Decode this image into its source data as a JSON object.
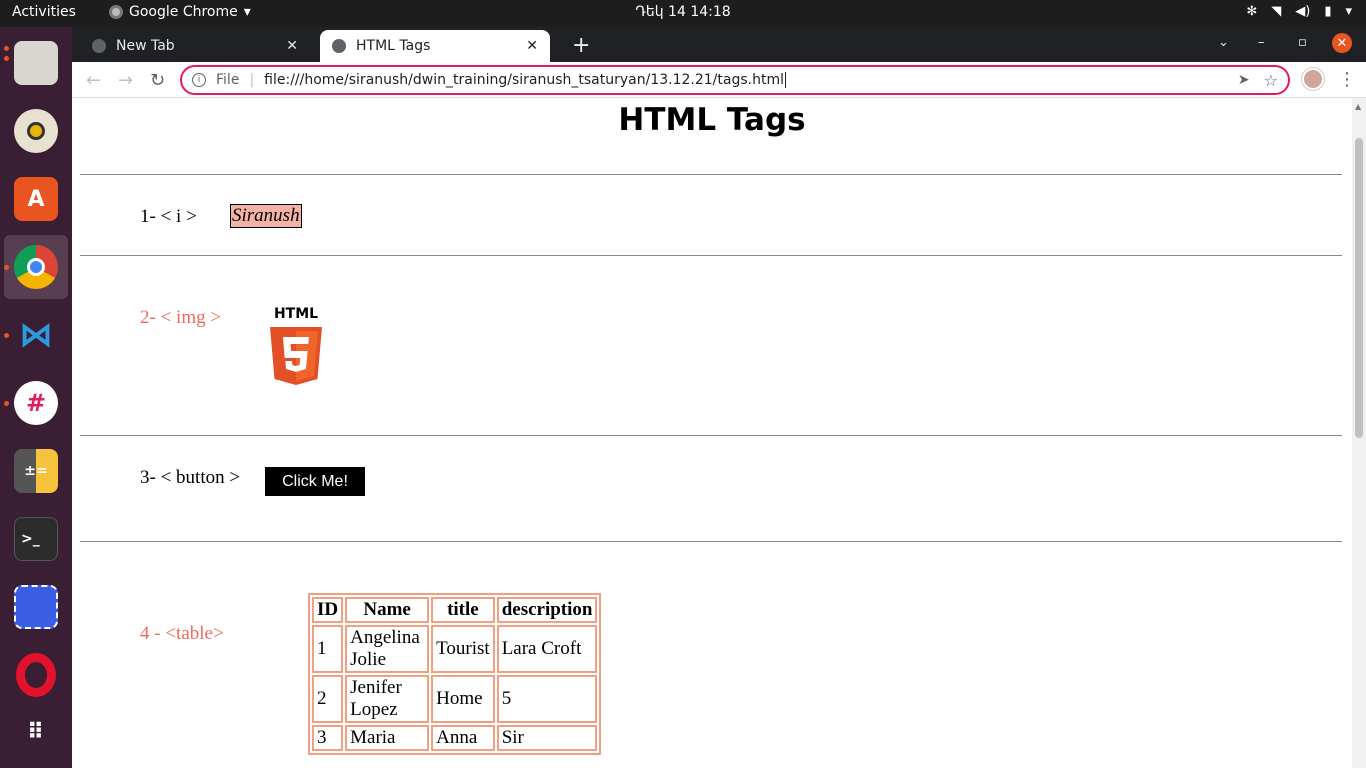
{
  "topbar": {
    "activities": "Activities",
    "app_name": "Google Chrome",
    "clock": "Դեկ 14  14:18"
  },
  "dock": {
    "items": [
      "files-icon",
      "rhythmbox-icon",
      "software-icon",
      "chrome-icon",
      "vscode-icon",
      "slack-icon",
      "calculator-icon",
      "terminal-icon",
      "screenshot-icon",
      "opera-icon",
      "app-grid-icon"
    ]
  },
  "browser": {
    "tabs": [
      {
        "label": "New Tab",
        "active": false
      },
      {
        "label": "HTML Tags",
        "active": true
      }
    ],
    "address": {
      "scheme": "File",
      "url": "file:///home/siranush/dwin_training/siranush_tsaturyan/13.12.21/tags.html"
    }
  },
  "page": {
    "title": "HTML Tags",
    "sections": {
      "italic": {
        "label": "1- < i >",
        "value": "Siranush"
      },
      "img": {
        "label": "2- < img >",
        "logo_text": "HTML",
        "logo_number": "5"
      },
      "button": {
        "label": "3- < button >",
        "button_text": "Click Me!"
      },
      "table": {
        "label": "4 - <table>",
        "headers": [
          "ID",
          "Name",
          "title",
          "description"
        ],
        "rows": [
          [
            "1",
            "Angelina Jolie",
            "Tourist",
            "Lara Croft"
          ],
          [
            "2",
            "Jenifer Lopez",
            "Home",
            "5"
          ],
          [
            "3",
            "Maria",
            "Anna",
            "Sir"
          ]
        ]
      }
    }
  },
  "colors": {
    "accent_salmon": "#f06a5a",
    "table_border": "#f0a080",
    "italic_bg": "#f5b3a5",
    "omnibox_border": "#e8175d"
  }
}
